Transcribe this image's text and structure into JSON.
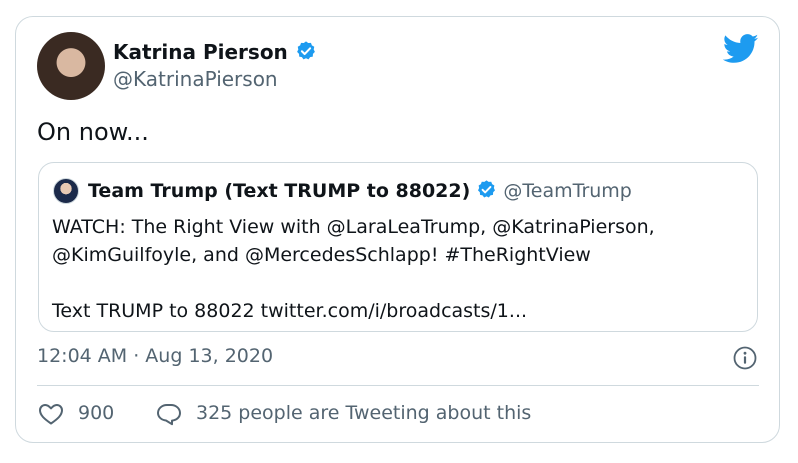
{
  "tweet": {
    "author_name": "Katrina Pierson",
    "author_handle": "@KatrinaPierson",
    "text": "On now...",
    "timestamp": "12:04 AM · Aug 13, 2020",
    "like_count": "900",
    "reply_text": "325 people are Tweeting about this"
  },
  "quoted_tweet": {
    "author_name": "Team Trump (Text TRUMP to 88022)",
    "author_handle": "@TeamTrump",
    "body_lines": [
      "WATCH: The Right View with @LaraLeaTrump, @KatrinaPierson,",
      "@KimGuilfoyle, and @MercedesSchlapp! #TheRightView",
      "",
      "Text TRUMP to 88022 twitter.com/i/broadcasts/1..."
    ]
  },
  "colors": {
    "brand_blue": "#1d9bf0",
    "muted_text": "#536471",
    "border": "#cfd9de",
    "text": "#0f1419"
  },
  "icons": [
    "twitter-bird-icon",
    "verified-badge-icon",
    "info-icon",
    "heart-icon",
    "speech-bubble-icon"
  ]
}
